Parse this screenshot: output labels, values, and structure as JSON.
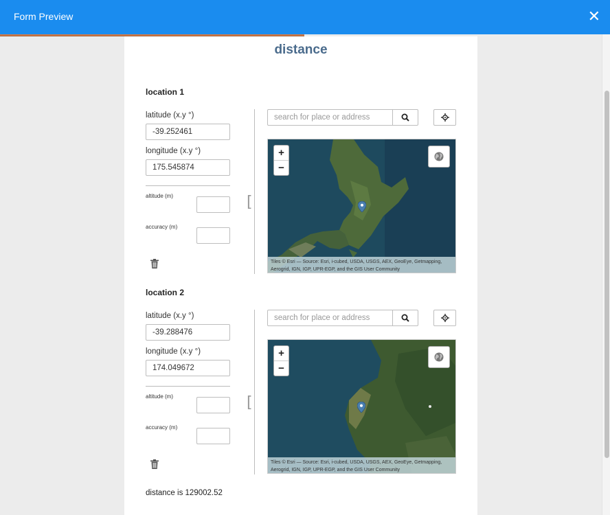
{
  "window": {
    "title": "Form Preview",
    "close_glyph": "✕"
  },
  "form": {
    "title": "distance"
  },
  "locations": [
    {
      "heading": "location 1",
      "latitude_label": "latitude (x.y °)",
      "latitude_value": "-39.252461",
      "longitude_label": "longitude (x.y °)",
      "longitude_value": "175.545874",
      "altitude_label": "altitude (m)",
      "accuracy_label": "accuracy (m)",
      "bracket": "[",
      "search_placeholder": "search for place or address",
      "map": {
        "zoom_in": "+",
        "zoom_out": "−",
        "attribution": "Tiles © Esri — Source: Esri, i-cubed, USDA, USGS, AEX, GeoEye, Getmapping, Aerogrid, IGN, IGP, UPR-EGP, and the GIS User Community"
      }
    },
    {
      "heading": "location 2",
      "latitude_label": "latitude (x.y °)",
      "latitude_value": "-39.288476",
      "longitude_label": "longitude (x.y °)",
      "longitude_value": "174.049672",
      "altitude_label": "altitude (m)",
      "accuracy_label": "accuracy (m)",
      "bracket": "[",
      "search_placeholder": "search for place or address",
      "map": {
        "zoom_in": "+",
        "zoom_out": "−",
        "attribution": "Tiles © Esri — Source: Esri, i-cubed, USDA, USGS, AEX, GeoEye, Getmapping, Aerogrid, IGN, IGP, UPR-EGP, and the GIS User Community"
      }
    }
  ],
  "result": {
    "text": "distance is 129002.52"
  },
  "colors": {
    "header": "#1a8cef",
    "title": "#4a6b8c",
    "progress": "#d37a47",
    "marker": "#4a7fb0"
  },
  "icons": [
    "close-icon",
    "search-icon",
    "crosshair-icon",
    "globe-icon",
    "trash-icon",
    "map-marker-icon"
  ]
}
